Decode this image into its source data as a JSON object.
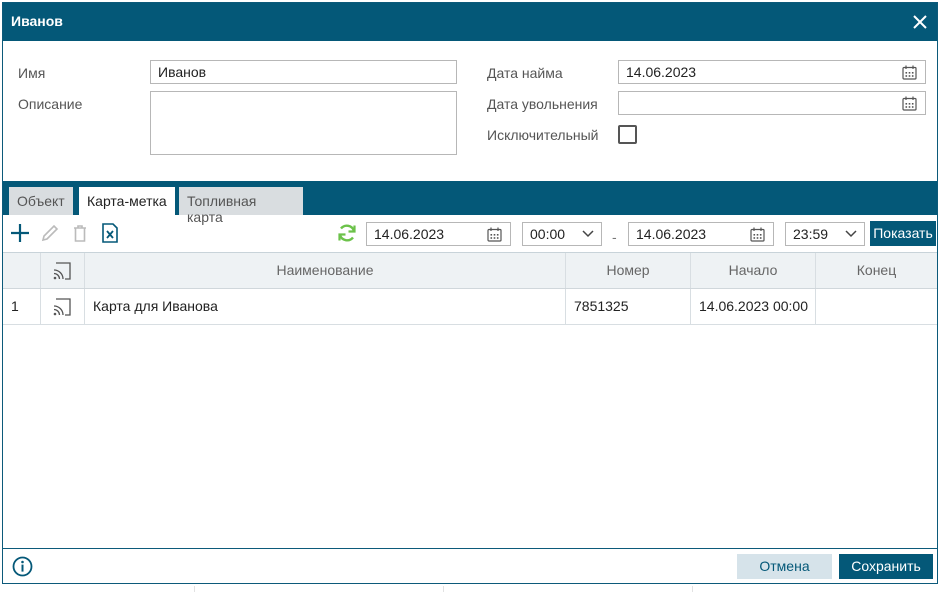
{
  "window": {
    "title": "Иванов"
  },
  "form": {
    "name_label": "Имя",
    "name_value": "Иванов",
    "description_label": "Описание",
    "description_value": "",
    "hire_date_label": "Дата найма",
    "hire_date_value": "14.06.2023",
    "dismiss_date_label": "Дата увольнения",
    "dismiss_date_value": "",
    "exclusive_label": "Исключительный",
    "exclusive_checked": false
  },
  "tabs": [
    {
      "label": "Объект",
      "active": false
    },
    {
      "label": "Карта-метка",
      "active": true
    },
    {
      "label": "Топливная карта",
      "active": false
    }
  ],
  "filter": {
    "date_from": "14.06.2023",
    "time_from": "00:00",
    "separator": "-",
    "date_to": "14.06.2023",
    "time_to": "23:59",
    "show_label": "Показать"
  },
  "table": {
    "columns": [
      "Наименование",
      "Номер",
      "Начало",
      "Конец"
    ],
    "rows": [
      {
        "index": "1",
        "name": "Карта для Иванова",
        "number": "7851325",
        "start": "14.06.2023 00:00",
        "end": ""
      }
    ]
  },
  "footer": {
    "cancel_label": "Отмена",
    "save_label": "Сохранить"
  },
  "colors": {
    "primary": "#045878",
    "accent_refresh": "#6cc24a",
    "tab_inactive": "#d9dde0"
  },
  "icons": [
    "close-icon",
    "calendar-icon",
    "add-icon",
    "edit-icon",
    "delete-icon",
    "excel-export-icon",
    "refresh-icon",
    "chevron-down-icon",
    "rfid-card-icon",
    "info-icon"
  ]
}
